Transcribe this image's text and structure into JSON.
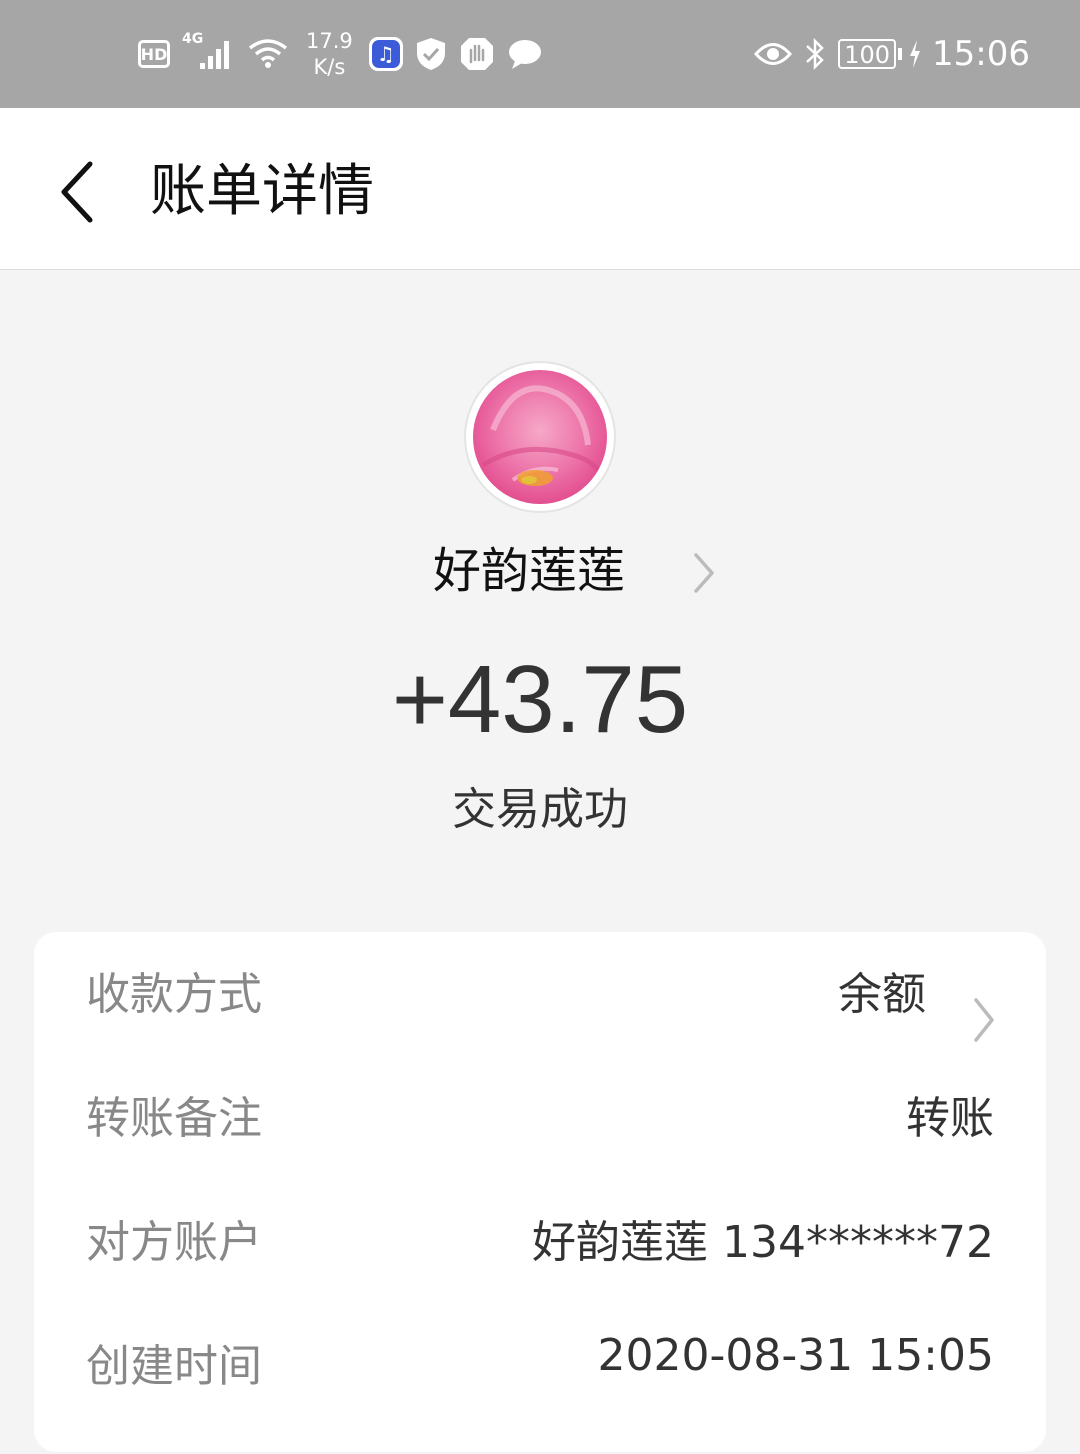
{
  "status_bar": {
    "hd_label": "HD",
    "network_label": "4G",
    "net_speed_value": "17.9",
    "net_speed_unit": "K/s",
    "battery_level": "100",
    "time": "15:06",
    "icons": [
      "hd-icon",
      "signal-icon",
      "wifi-icon",
      "music-app-icon",
      "shield-icon",
      "hand-icon",
      "chat-icon",
      "eye-icon",
      "bluetooth-icon",
      "battery-icon",
      "charging-icon"
    ]
  },
  "header": {
    "title": "账单详情",
    "back_icon": "chevron-left-icon"
  },
  "summary": {
    "avatar_icon": "pink-flower-avatar",
    "counterparty_name": "好韵莲莲",
    "amount": "+43.75",
    "status": "交易成功"
  },
  "details": [
    {
      "label": "收款方式",
      "value": "余额",
      "has_chevron": true
    },
    {
      "label": "转账备注",
      "value": "转账",
      "has_chevron": false
    },
    {
      "label": "对方账户",
      "value": "好韵莲莲 134******72",
      "has_chevron": false
    },
    {
      "label": "创建时间",
      "value": "2020-08-31 15:05",
      "has_chevron": false
    }
  ],
  "colors": {
    "status_bar_bg": "#a6a6a6",
    "page_bg": "#f4f4f4",
    "card_bg": "#ffffff",
    "label_text": "#888888",
    "value_text": "#333333"
  }
}
